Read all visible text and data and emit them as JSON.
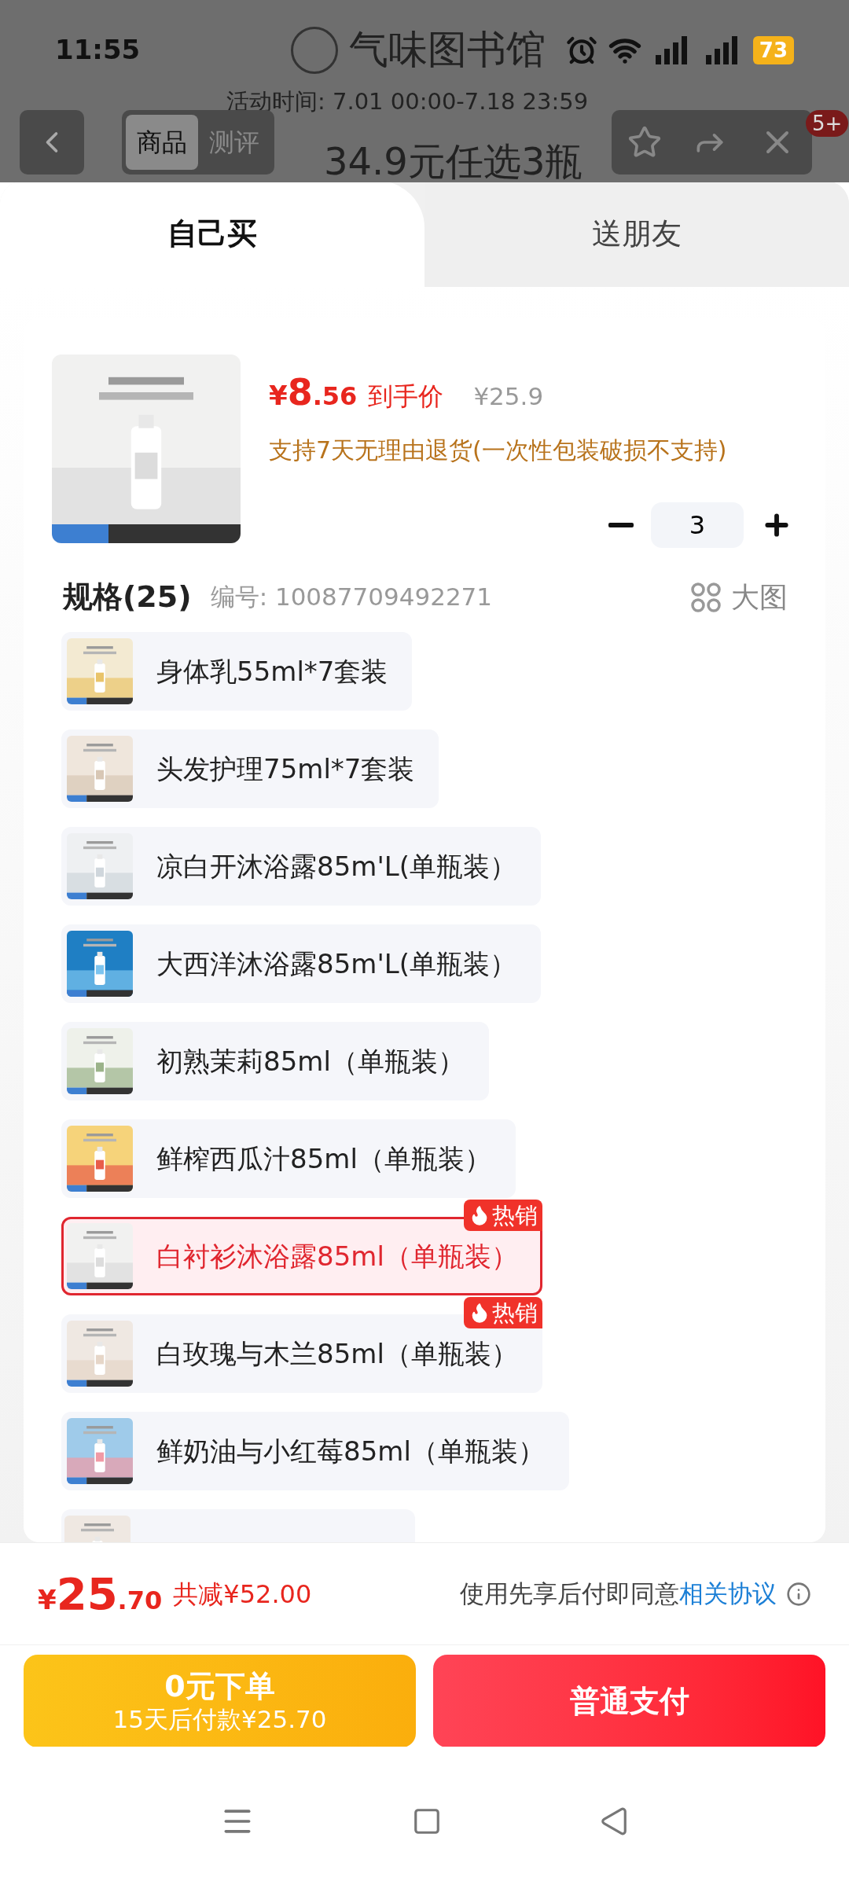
{
  "status_bar": {
    "time": "11:55",
    "battery": "73"
  },
  "header": {
    "shop_name": "气味图书馆",
    "activity_time": "活动时间: 7.01 00:00-7.18 23:59",
    "headline": "34.9元任选3瓶",
    "badge": "5+",
    "tabs": [
      {
        "label": "商品",
        "selected": true
      },
      {
        "label": "测评",
        "selected": false
      }
    ]
  },
  "sheet_tabs": [
    {
      "label": "自己买",
      "selected": true
    },
    {
      "label": "送朋友",
      "selected": false
    }
  ],
  "product": {
    "currency": "¥",
    "price_int": "8",
    "price_dec": ".56",
    "price_label": "到手价",
    "original_price": "¥25.9",
    "return_policy": "支持7天无理由退货(一次性包装破损不支持)",
    "quantity": "3"
  },
  "specs": {
    "title": "规格(25)",
    "code": "编号: 10087709492271",
    "view_toggle": "大图",
    "partially_visible_item": true,
    "items": [
      {
        "label": "身体乳55ml*7套装",
        "selected": false
      },
      {
        "label": "头发护理75ml*7套装",
        "selected": false
      },
      {
        "label": "凉白开沐浴露85m'L(单瓶装）",
        "selected": false
      },
      {
        "label": "大西洋沐浴露85m'L(单瓶装）",
        "selected": false
      },
      {
        "label": "初熟茉莉85ml（单瓶装）",
        "selected": false
      },
      {
        "label": "鲜榨西瓜汁85ml（单瓶装）",
        "selected": false
      },
      {
        "label": "白衬衫沐浴露85ml（单瓶装）",
        "selected": true,
        "badge": "热销"
      },
      {
        "label": "白玫瑰与木兰85ml（单瓶装）",
        "selected": false,
        "badge": "热销"
      },
      {
        "label": "鲜奶油与小红莓85ml（单瓶装）",
        "selected": false
      }
    ]
  },
  "footer": {
    "currency": "¥",
    "total_int": "25",
    "total_dec": ".70",
    "discount": "共减¥52.00",
    "agreement": "使用先享后付即同意",
    "agreement_link": "相关协议"
  },
  "buttons": [
    {
      "kind": "later",
      "title": "0元下单",
      "subtitle": "15天后付款¥25.70"
    },
    {
      "kind": "pay",
      "title": "普通支付"
    }
  ]
}
